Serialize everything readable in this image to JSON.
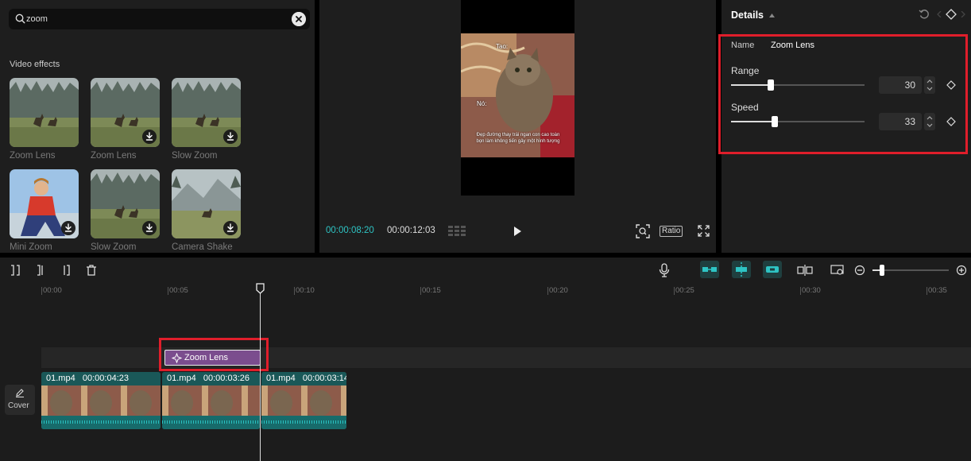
{
  "search": {
    "value": "zoom",
    "placeholder": "Search"
  },
  "effects_panel": {
    "section_title": "Video effects",
    "items": [
      {
        "label": "Zoom Lens",
        "downloaded": true
      },
      {
        "label": "Zoom Lens",
        "downloaded": false
      },
      {
        "label": "Slow Zoom",
        "downloaded": false
      },
      {
        "label": "Mini Zoom",
        "downloaded": false
      },
      {
        "label": "Slow Zoom",
        "downloaded": false
      },
      {
        "label": "Camera Shake",
        "downloaded": false
      }
    ]
  },
  "preview": {
    "time_current": "00:00:08:20",
    "time_total": "00:00:12:03",
    "ratio_label": "Ratio",
    "caption_top": "Tao:",
    "caption_mid": "Nó:",
    "caption_bottom": "Đẹp đường thay trái ngan con cao toàn bọn làm không tiến gây một hình tượng"
  },
  "details": {
    "title": "Details",
    "name_label": "Name",
    "name_value": "Zoom Lens",
    "range_label": "Range",
    "range_value": "30",
    "range_fraction": 0.3,
    "speed_label": "Speed",
    "speed_value": "33",
    "speed_fraction": 0.33
  },
  "timeline": {
    "ticks": [
      "00:00",
      "00:05",
      "00:10",
      "00:15",
      "00:20",
      "00:25",
      "00:30",
      "00:35"
    ],
    "effect_clip_label": "Zoom Lens",
    "cover_label": "Cover",
    "clips": [
      {
        "name": "01.mp4",
        "duration": "00:00:04:23"
      },
      {
        "name": "01.mp4",
        "duration": "00:00:03:26"
      },
      {
        "name": "01.mp4",
        "duration": "00:00:03:14"
      }
    ]
  },
  "colors": {
    "accent_cyan": "#2ec4c4",
    "highlight_red": "#e01e2b",
    "effect_purple": "#7b4d8e",
    "clip_teal": "#1a5858"
  }
}
